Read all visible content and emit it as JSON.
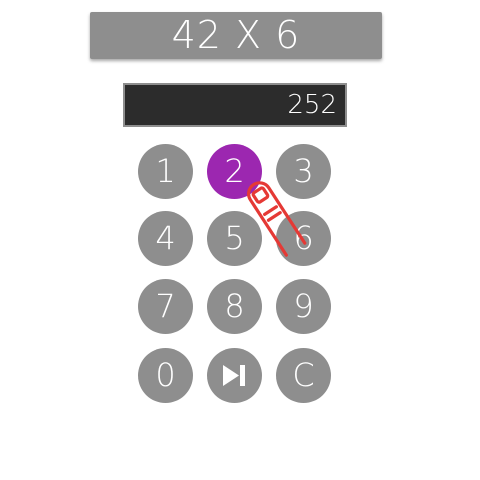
{
  "question": {
    "text": "42 X 6"
  },
  "answer": {
    "value": "252"
  },
  "keypad": {
    "keys": [
      "1",
      "2",
      "3",
      "4",
      "5",
      "6",
      "7",
      "8",
      "9",
      "0",
      "next",
      "C"
    ],
    "active_key": "2",
    "next_icon": "skip-next-icon"
  },
  "colors": {
    "key": "#8e8e8e",
    "key_active": "#9c27b0",
    "display_bg": "#2c2c2c",
    "touch_indicator": "#e53935"
  }
}
